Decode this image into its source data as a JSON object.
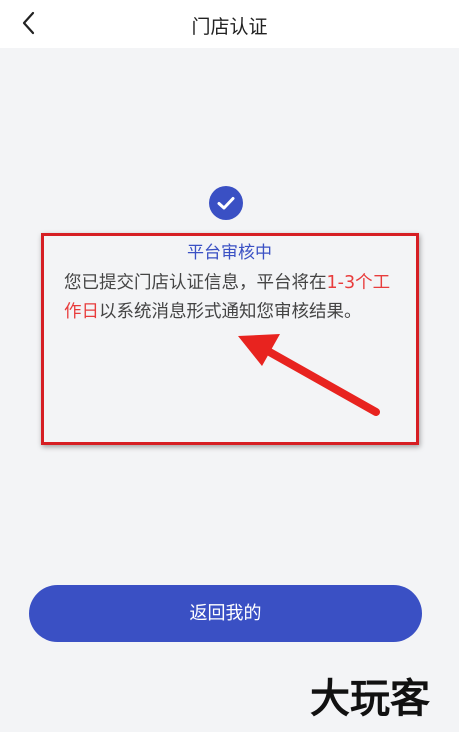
{
  "header": {
    "title": "门店认证",
    "back_icon": "chevron-left-icon"
  },
  "status": {
    "icon": "check-circle-icon",
    "title": "平台审核中",
    "message_part1": "您已提交门店认证信息，平台将在",
    "message_highlight": "1-3个工作日",
    "message_part2": "以系统消息形式通知您审核结果。"
  },
  "actions": {
    "return_label": "返回我的"
  },
  "watermark": {
    "text": "大玩客"
  },
  "colors": {
    "accent": "#3a50c4",
    "highlight": "#e83c3c",
    "annotation": "#d61e23",
    "background": "#f3f4f6"
  }
}
